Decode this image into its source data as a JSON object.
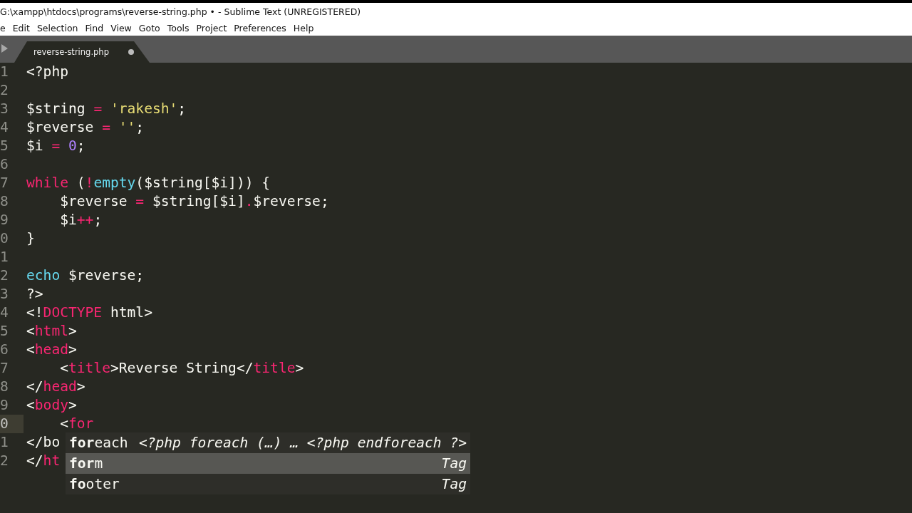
{
  "window": {
    "title": "G:\\xampp\\htdocs\\programs\\reverse-string.php • - Sublime Text (UNREGISTERED)"
  },
  "menu": [
    "e",
    "Edit",
    "Selection",
    "Find",
    "View",
    "Goto",
    "Tools",
    "Project",
    "Preferences",
    "Help"
  ],
  "tabs": [
    {
      "label": "reverse-string.php",
      "selected": true,
      "modified": true
    }
  ],
  "editor": {
    "lines": [
      {
        "number": "1",
        "current": false,
        "tokens": [
          {
            "kind": "plain",
            "text": "<?php"
          }
        ]
      },
      {
        "number": "2",
        "current": false
      },
      {
        "number": "3",
        "current": false,
        "tokens": [
          {
            "kind": "plain",
            "text": "$string "
          },
          {
            "kind": "keyword",
            "text": "="
          },
          {
            "kind": "string",
            "text": " 'rakesh'"
          },
          {
            "kind": "plain",
            "text": ";"
          }
        ]
      },
      {
        "number": "4",
        "current": false,
        "tokens": [
          {
            "kind": "plain",
            "text": "$reverse "
          },
          {
            "kind": "keyword",
            "text": "="
          },
          {
            "kind": "string",
            "text": " ''"
          },
          {
            "kind": "plain",
            "text": ";"
          }
        ]
      },
      {
        "number": "5",
        "current": false,
        "tokens": [
          {
            "kind": "plain",
            "text": "$i "
          },
          {
            "kind": "keyword",
            "text": "="
          },
          {
            "kind": "number",
            "text": " 0"
          },
          {
            "kind": "plain",
            "text": ";"
          }
        ]
      },
      {
        "number": "6",
        "current": false
      },
      {
        "number": "7",
        "current": false,
        "tokens": [
          {
            "kind": "keyword",
            "text": "while"
          },
          {
            "kind": "plain",
            "text": " ("
          },
          {
            "kind": "keyword",
            "text": "!"
          },
          {
            "kind": "function",
            "text": "empty"
          },
          {
            "kind": "plain",
            "text": "($string[$i])) {"
          }
        ]
      },
      {
        "number": "8",
        "current": false,
        "tokens": [
          {
            "kind": "plain",
            "text": "    $reverse "
          },
          {
            "kind": "keyword",
            "text": "="
          },
          {
            "kind": "plain",
            "text": " $string[$i]"
          },
          {
            "kind": "keyword",
            "text": "."
          },
          {
            "kind": "plain",
            "text": "$reverse;"
          }
        ]
      },
      {
        "number": "9",
        "current": false,
        "tokens": [
          {
            "kind": "plain",
            "text": "    $i"
          },
          {
            "kind": "keyword",
            "text": "++"
          },
          {
            "kind": "plain",
            "text": ";"
          }
        ]
      },
      {
        "number": "0",
        "current": false,
        "tokens": [
          {
            "kind": "plain",
            "text": "}"
          }
        ]
      },
      {
        "number": "1",
        "current": false
      },
      {
        "number": "2",
        "current": false,
        "tokens": [
          {
            "kind": "function",
            "text": "echo"
          },
          {
            "kind": "plain",
            "text": " $reverse;"
          }
        ]
      },
      {
        "number": "3",
        "current": false,
        "tokens": [
          {
            "kind": "plain",
            "text": "?>"
          }
        ]
      },
      {
        "number": "4",
        "current": false,
        "tokens": [
          {
            "kind": "plain",
            "text": "<!"
          },
          {
            "kind": "keyword",
            "text": "DOCTYPE"
          },
          {
            "kind": "plain",
            "text": " html>"
          }
        ]
      },
      {
        "number": "5",
        "current": false,
        "tokens": [
          {
            "kind": "plain",
            "text": "<"
          },
          {
            "kind": "keyword",
            "text": "html"
          },
          {
            "kind": "plain",
            "text": ">"
          }
        ]
      },
      {
        "number": "6",
        "current": false,
        "tokens": [
          {
            "kind": "plain",
            "text": "<"
          },
          {
            "kind": "keyword",
            "text": "head"
          },
          {
            "kind": "plain",
            "text": ">"
          }
        ]
      },
      {
        "number": "7",
        "current": false,
        "tokens": [
          {
            "kind": "plain",
            "text": "    <"
          },
          {
            "kind": "keyword",
            "text": "title"
          },
          {
            "kind": "plain",
            "text": ">Reverse String</"
          },
          {
            "kind": "keyword",
            "text": "title"
          },
          {
            "kind": "plain",
            "text": ">"
          }
        ]
      },
      {
        "number": "8",
        "current": false,
        "tokens": [
          {
            "kind": "plain",
            "text": "</"
          },
          {
            "kind": "keyword",
            "text": "head"
          },
          {
            "kind": "plain",
            "text": ">"
          }
        ]
      },
      {
        "number": "9",
        "current": false,
        "tokens": [
          {
            "kind": "plain",
            "text": "<"
          },
          {
            "kind": "keyword",
            "text": "body"
          },
          {
            "kind": "plain",
            "text": ">"
          }
        ]
      },
      {
        "number": "0",
        "current": true,
        "tokens": [
          {
            "kind": "plain",
            "text": "    <"
          },
          {
            "kind": "keyword",
            "text": "for"
          }
        ]
      },
      {
        "number": "1",
        "current": false,
        "tokens": [
          {
            "kind": "plain",
            "text": "</bo"
          }
        ]
      },
      {
        "number": "2",
        "current": false,
        "tokens": [
          {
            "kind": "plain",
            "text": "</"
          },
          {
            "kind": "keyword",
            "text": "ht"
          }
        ]
      }
    ]
  },
  "autocomplete": {
    "items": [
      {
        "label": "**for**each",
        "hint": "<?php foreach (…) … <?php endforeach ?>",
        "selected": false
      },
      {
        "label": "**for**m",
        "hint": "Tag",
        "selected": true
      },
      {
        "label": "**fo**oter",
        "hint": "Tag",
        "selected": false
      }
    ]
  }
}
